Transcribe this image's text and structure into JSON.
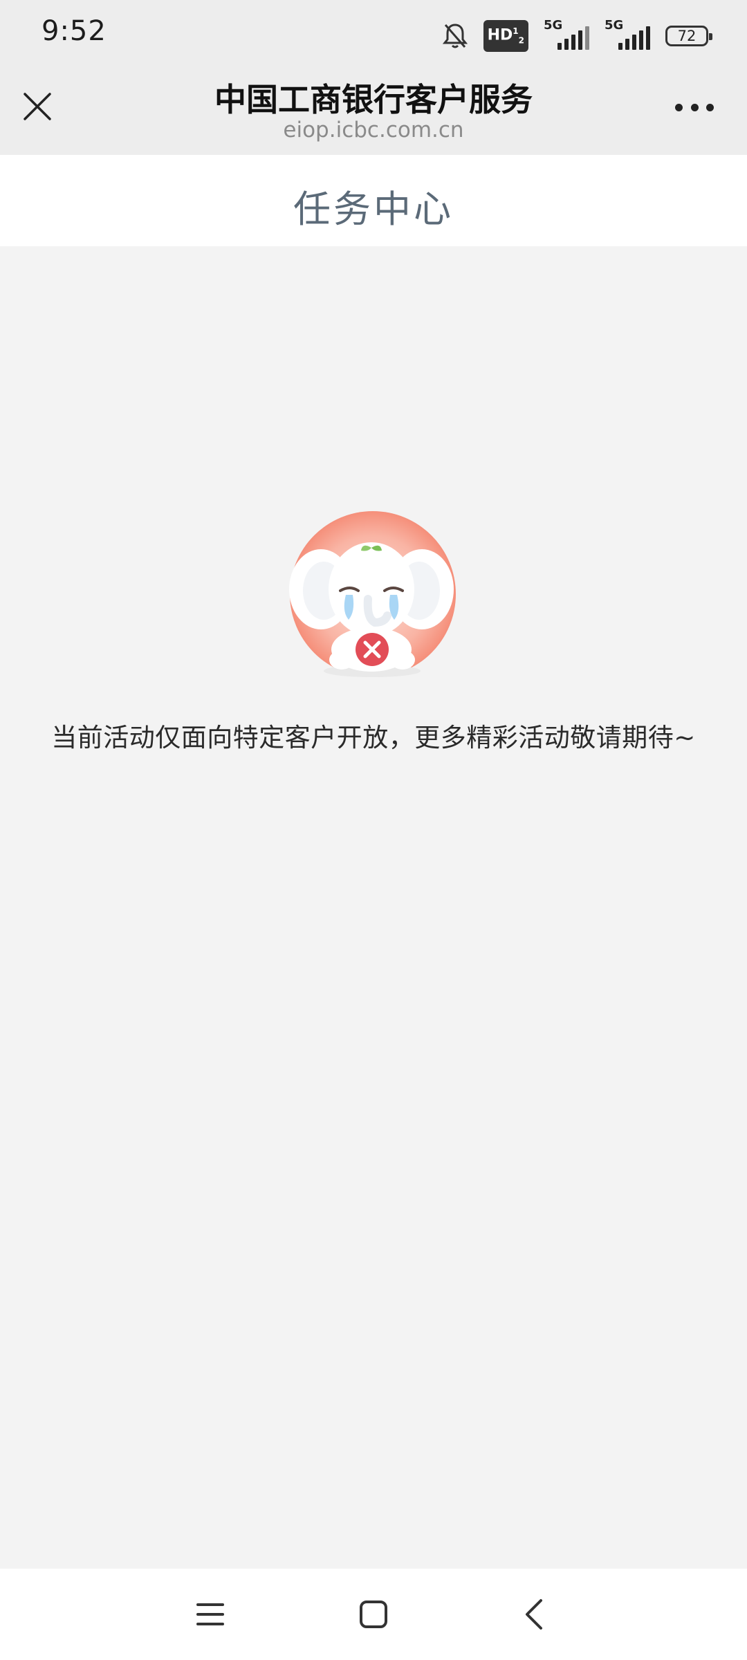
{
  "status_bar": {
    "time": "9:52",
    "hd_label": "HD",
    "hd_sub": "1",
    "hd_sub2": "2",
    "signal_1_label": "5G",
    "signal_2_label": "5G",
    "battery": "72",
    "icons": [
      "mute-bell-icon",
      "hd-icon",
      "signal-icon",
      "signal-icon",
      "battery-icon"
    ]
  },
  "title_bar": {
    "title": "中国工商银行客户服务",
    "url": "eiop.icbc.com.cn",
    "close_icon": "close-icon",
    "more_icon": "more-icon"
  },
  "page": {
    "title": "任务中心"
  },
  "content": {
    "mascot": "crying-elephant-mascot",
    "message": "当前活动仅面向特定客户开放，更多精彩活动敬请期待~"
  },
  "nav_bar": {
    "items": [
      "menu-icon",
      "home-icon",
      "back-icon"
    ]
  },
  "colors": {
    "chrome_bg": "#ededed",
    "content_bg": "#f3f3f3",
    "page_title": "#5b6a78",
    "mascot_circle": "#f7a594",
    "error_badge": "#e24d57"
  }
}
